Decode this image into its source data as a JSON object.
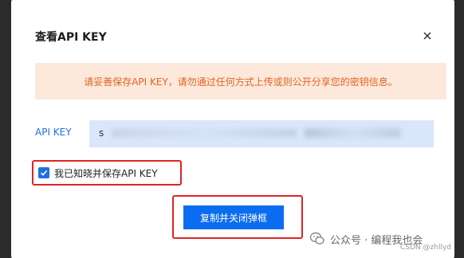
{
  "dialog": {
    "title": "查看API KEY",
    "close_icon": "close-icon"
  },
  "warning": {
    "text": "请妥善保存API KEY，请勿通过任何方式上传或则公开分享您的密钥信息。"
  },
  "api_key": {
    "label": "API KEY",
    "value_visible_prefix": "s"
  },
  "checkbox": {
    "label": "我已知晓并保存API KEY",
    "checked": true
  },
  "buttons": {
    "copy_close": "复制并关闭弹框"
  },
  "watermark": {
    "text": "公众号 · 编程我也会",
    "csdn": "CSDN @zhllyd"
  },
  "colors": {
    "primary": "#0a6cf0",
    "warning_bg": "#fde8dc",
    "warning_text": "#e3641d",
    "highlight_red": "#e02424"
  }
}
